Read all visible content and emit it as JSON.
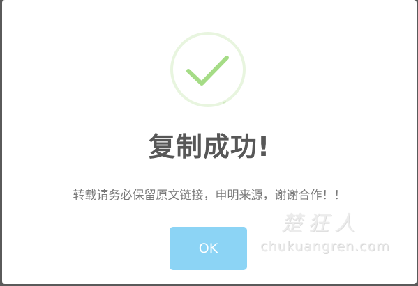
{
  "dialog": {
    "icon": "success-check-icon",
    "title": "复制成功!",
    "message": "转载请务必保留原文链接，申明来源，谢谢合作！！",
    "ok_label": "OK"
  },
  "watermark": {
    "chars": "楚狂人",
    "url": "chukuangren.com"
  },
  "colors": {
    "check_stroke": "#a5dc86",
    "ring_stroke": "#e8f5df",
    "button_bg": "#8cd4f5",
    "title": "#575757",
    "message": "#797979"
  }
}
